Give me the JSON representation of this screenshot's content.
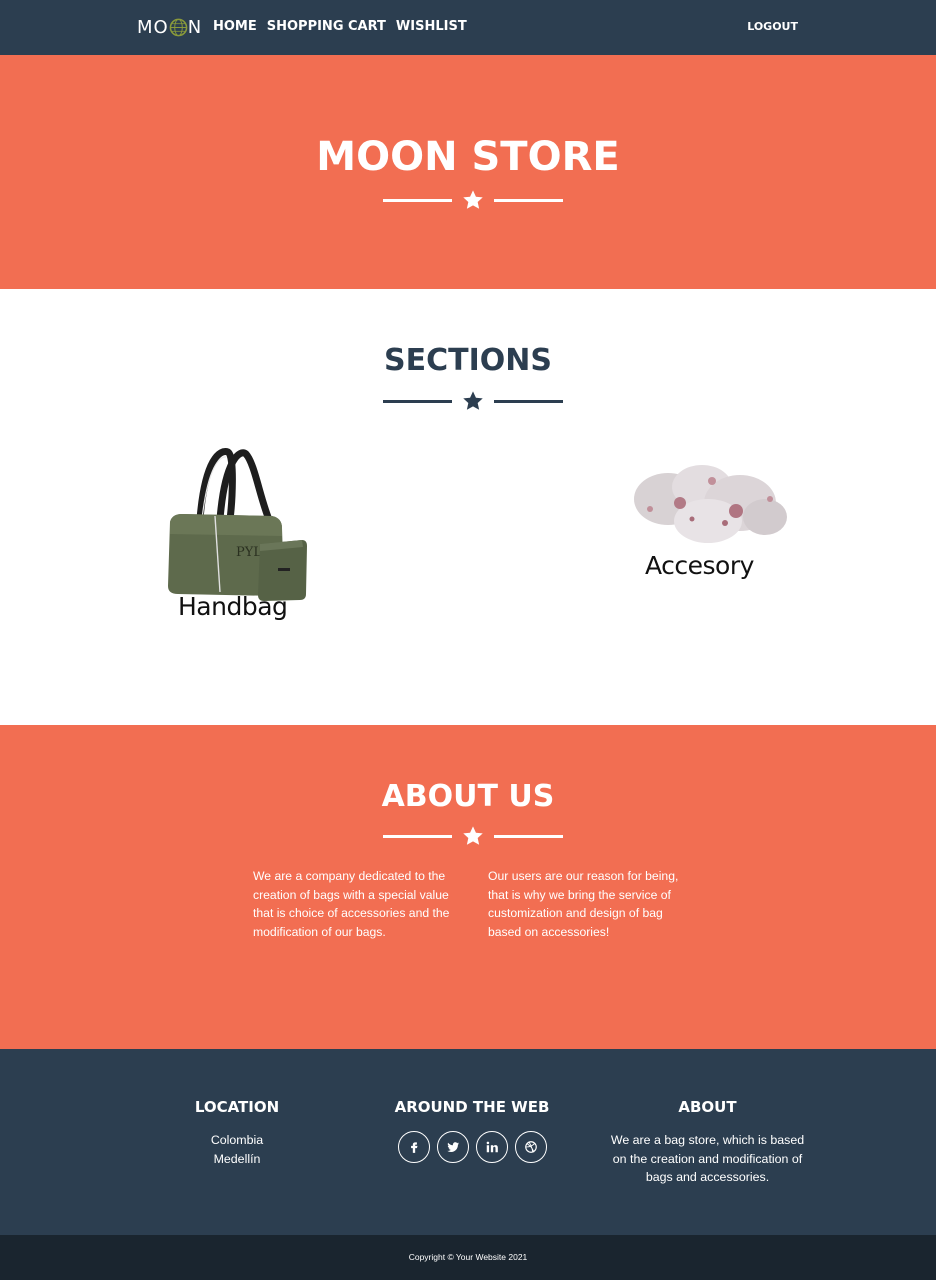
{
  "navbar": {
    "brand_left": "MO",
    "brand_right": "N",
    "links": [
      "Home",
      "Shopping Cart",
      "Wishlist"
    ],
    "logout": "LOGOUT"
  },
  "hero": {
    "title": "MOON STORE"
  },
  "sections": {
    "title": "SECTIONS",
    "cards": [
      {
        "label": "Handbag"
      },
      {
        "label": "Accesory"
      }
    ]
  },
  "about": {
    "title": "ABOUT US",
    "col1": "We are a company dedicated to the creation of bags with a special value that is choice of accessories and the modification of our bags.",
    "col2": "Our users are our reason for being, that is why we bring the service of customization and design of bag based on accessories!"
  },
  "footer": {
    "location": {
      "heading": "LOCATION",
      "line1": "Colombia",
      "line2": "Medellín"
    },
    "web": {
      "heading": "AROUND THE WEB",
      "icons": [
        "facebook-icon",
        "twitter-icon",
        "linkedin-icon",
        "dribbble-icon"
      ]
    },
    "about": {
      "heading": "ABOUT",
      "text": "We are a bag store, which is based on the creation and modification of bags and accessories."
    },
    "copyright": "Copyright © Your Website 2021"
  },
  "colors": {
    "navy": "#2c3e50",
    "coral": "#f26e52",
    "dark": "#1a252f",
    "white": "#ffffff"
  }
}
